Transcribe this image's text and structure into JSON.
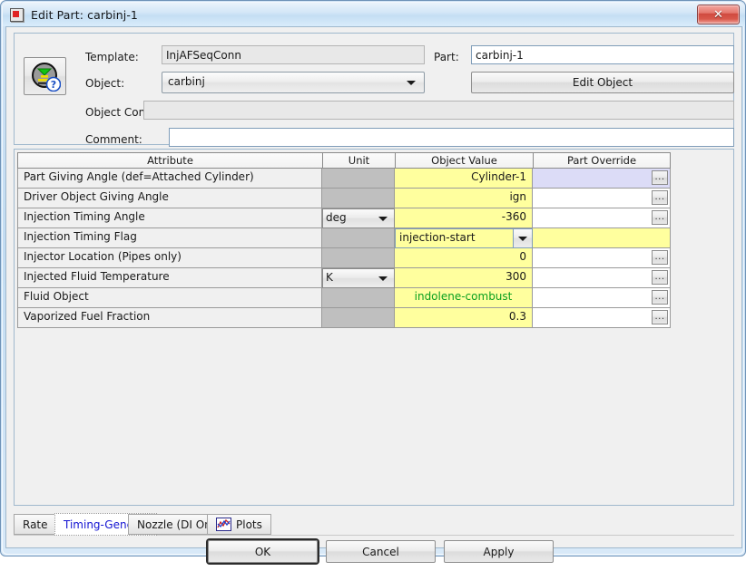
{
  "window": {
    "title": "Edit Part: carbinj-1",
    "title_icon": "app-box-icon",
    "close_label": "✕"
  },
  "form": {
    "object_icon": "injector-object-icon",
    "template_label": "Template:",
    "template_value": "InjAFSeqConn",
    "object_label": "Object:",
    "object_value": "carbinj",
    "object_comment_label": "Object Comment:",
    "object_comment_value": "",
    "comment_label": "Comment:",
    "comment_value": "",
    "part_label": "Part:",
    "part_value": "carbinj-1",
    "edit_object_label": "Edit Object"
  },
  "table": {
    "columns": [
      "Attribute",
      "Unit",
      "Object Value",
      "Part Override"
    ],
    "rows": [
      {
        "attribute": "Part Giving Angle (def=Attached Cylinder)",
        "unit": "",
        "unit_type": "none",
        "value": "Cylinder-1",
        "value_type": "text",
        "override": "",
        "override_style": "lavender",
        "override_button": "..."
      },
      {
        "attribute": "Driver Object Giving Angle",
        "unit": "",
        "unit_type": "none",
        "value": "ign",
        "value_type": "text",
        "override": "",
        "override_style": "white",
        "override_button": "..."
      },
      {
        "attribute": "Injection Timing Angle",
        "unit": "deg",
        "unit_type": "combo",
        "value": "-360",
        "value_type": "text",
        "override": "",
        "override_style": "white",
        "override_button": "..."
      },
      {
        "attribute": "Injection Timing Flag",
        "unit": "",
        "unit_type": "none",
        "value": "injection-start",
        "value_type": "combo",
        "override": "",
        "override_style": "yellow",
        "override_button": ""
      },
      {
        "attribute": "Injector Location (Pipes only)",
        "unit": "",
        "unit_type": "none",
        "value": "0",
        "value_type": "text",
        "override": "",
        "override_style": "white",
        "override_button": "..."
      },
      {
        "attribute": "Injected Fluid Temperature",
        "unit": "K",
        "unit_type": "combo",
        "value": "300",
        "value_type": "text",
        "override": "",
        "override_style": "white",
        "override_button": "..."
      },
      {
        "attribute": "Fluid Object",
        "unit": "",
        "unit_type": "none",
        "value": "indolene-combust",
        "value_type": "green",
        "override": "",
        "override_style": "white",
        "override_button": "..."
      },
      {
        "attribute": "Vaporized Fuel Fraction",
        "unit": "",
        "unit_type": "none",
        "value": "0.3",
        "value_type": "text",
        "override": "",
        "override_style": "white",
        "override_button": "..."
      }
    ]
  },
  "tabs": [
    {
      "label": "Rate",
      "selected": false,
      "icon": ""
    },
    {
      "label": "Timing-General",
      "selected": true,
      "icon": ""
    },
    {
      "label": "Nozzle (DI Only)",
      "selected": false,
      "icon": ""
    },
    {
      "label": "Plots",
      "selected": false,
      "icon": "chart-icon"
    }
  ],
  "buttons": {
    "ok": "OK",
    "cancel": "Cancel",
    "apply": "Apply"
  },
  "colors": {
    "value_cell": "#ffff9e",
    "override_active": "#dcdcf7",
    "green_text": "#0aa01e",
    "selected_tab_text": "#1414d2",
    "unit_disabled": "#bfbfbf"
  }
}
